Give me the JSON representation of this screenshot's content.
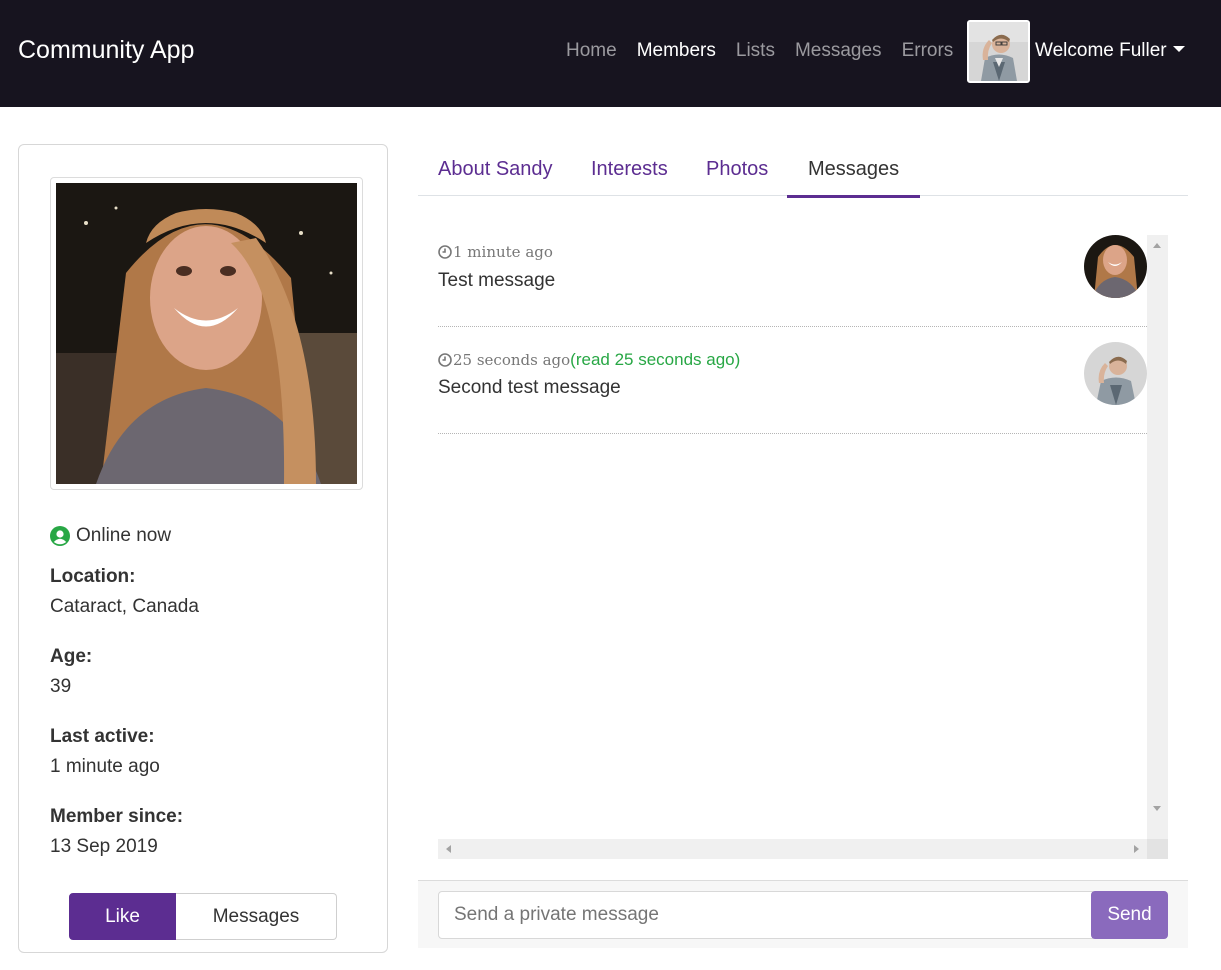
{
  "navbar": {
    "brand": "Community App",
    "links": [
      {
        "label": "Home",
        "active": false
      },
      {
        "label": "Members",
        "active": true
      },
      {
        "label": "Lists",
        "active": false
      },
      {
        "label": "Messages",
        "active": false
      },
      {
        "label": "Errors",
        "active": false
      }
    ],
    "welcome": "Welcome Fuller"
  },
  "profile": {
    "status": "Online now",
    "location_label": "Location:",
    "location": "Cataract, Canada",
    "age_label": "Age:",
    "age": "39",
    "last_active_label": "Last active:",
    "last_active": "1 minute ago",
    "member_since_label": "Member since:",
    "member_since": "13 Sep 2019",
    "like_label": "Like",
    "messages_label": "Messages"
  },
  "tabs": [
    {
      "label": "About Sandy",
      "active": false
    },
    {
      "label": "Interests",
      "active": false
    },
    {
      "label": "Photos",
      "active": false
    },
    {
      "label": "Messages",
      "active": true
    }
  ],
  "messages": [
    {
      "time": "1 minute ago",
      "read": "",
      "text": "Test message",
      "sender": "Sandy"
    },
    {
      "time": "25 seconds ago",
      "read": "(read 25 seconds ago)",
      "text": "Second test message",
      "sender": "Fuller"
    }
  ],
  "composer": {
    "placeholder": "Send a private message",
    "send_label": "Send"
  },
  "colors": {
    "navbar": "#17141f",
    "accent": "#5c2d91",
    "online": "#28a745",
    "send": "#8a6abd"
  }
}
